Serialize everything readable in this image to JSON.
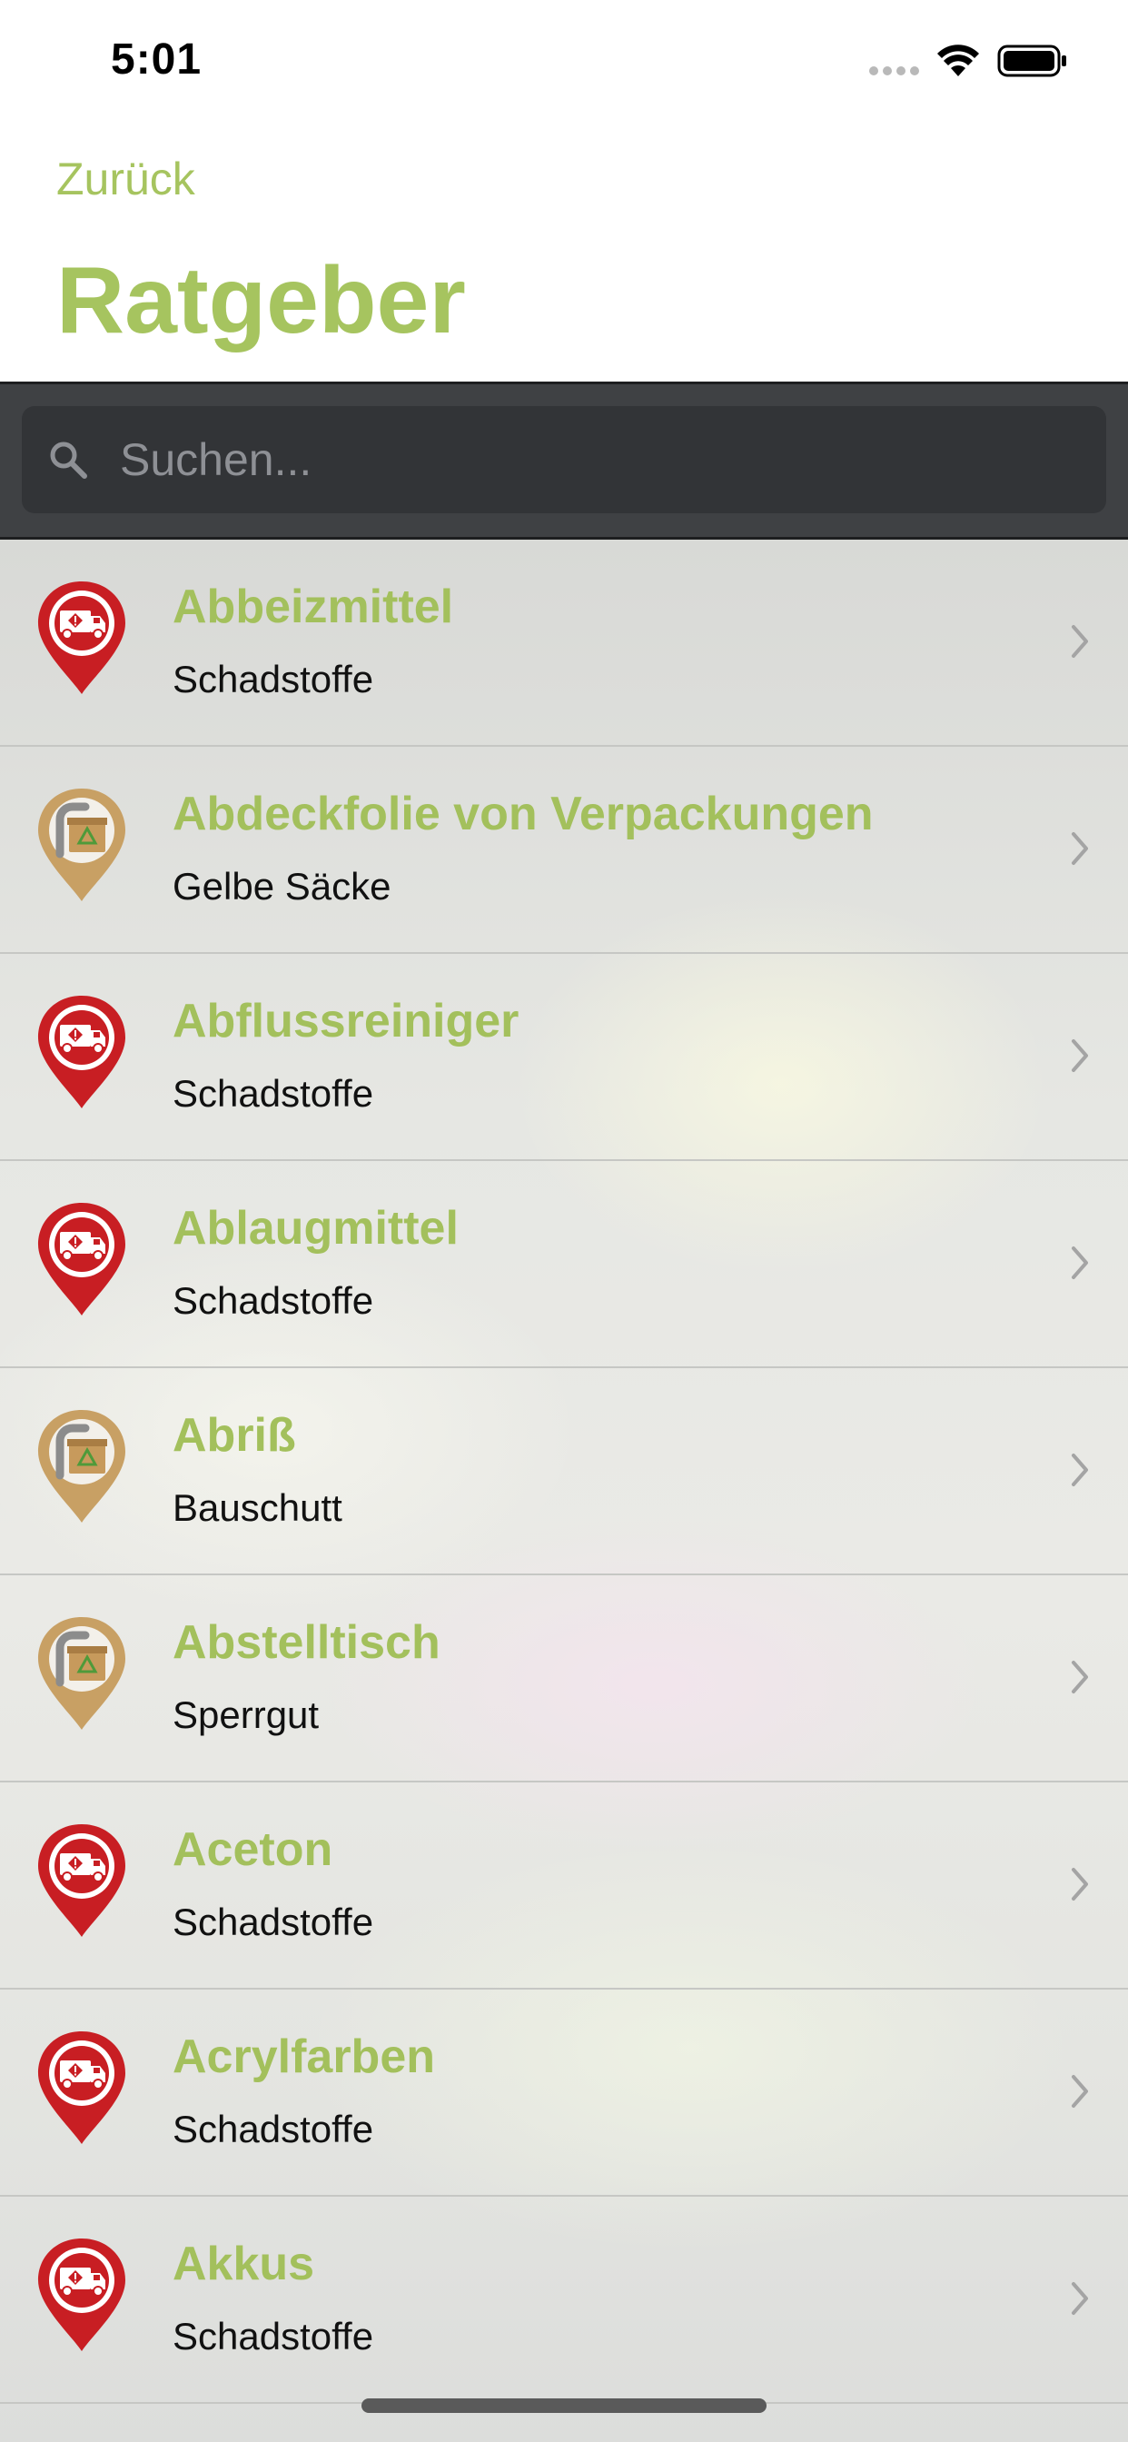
{
  "status_bar": {
    "time": "5:01"
  },
  "nav": {
    "back_label": "Zurück",
    "title": "Ratgeber"
  },
  "search": {
    "placeholder": "Suchen..."
  },
  "colors": {
    "accent": "#a6c45f",
    "hazard_red": "#c81e23",
    "bulky_tan": "#c8a064"
  },
  "items": [
    {
      "title": "Abbeizmittel",
      "subtitle": "Schadstoffe",
      "icon": "hazard-truck-pin-icon"
    },
    {
      "title": "Abdeckfolie von Verpackungen",
      "subtitle": "Gelbe Säcke",
      "icon": "waste-container-pin-icon"
    },
    {
      "title": "Abflussreiniger",
      "subtitle": "Schadstoffe",
      "icon": "hazard-truck-pin-icon"
    },
    {
      "title": "Ablaugmittel",
      "subtitle": "Schadstoffe",
      "icon": "hazard-truck-pin-icon"
    },
    {
      "title": "Abriß",
      "subtitle": "Bauschutt",
      "icon": "waste-container-pin-icon"
    },
    {
      "title": "Abstelltisch",
      "subtitle": "Sperrgut",
      "icon": "waste-container-pin-icon"
    },
    {
      "title": "Aceton",
      "subtitle": "Schadstoffe",
      "icon": "hazard-truck-pin-icon"
    },
    {
      "title": "Acrylfarben",
      "subtitle": "Schadstoffe",
      "icon": "hazard-truck-pin-icon"
    },
    {
      "title": "Akkus",
      "subtitle": "Schadstoffe",
      "icon": "hazard-truck-pin-icon"
    }
  ]
}
